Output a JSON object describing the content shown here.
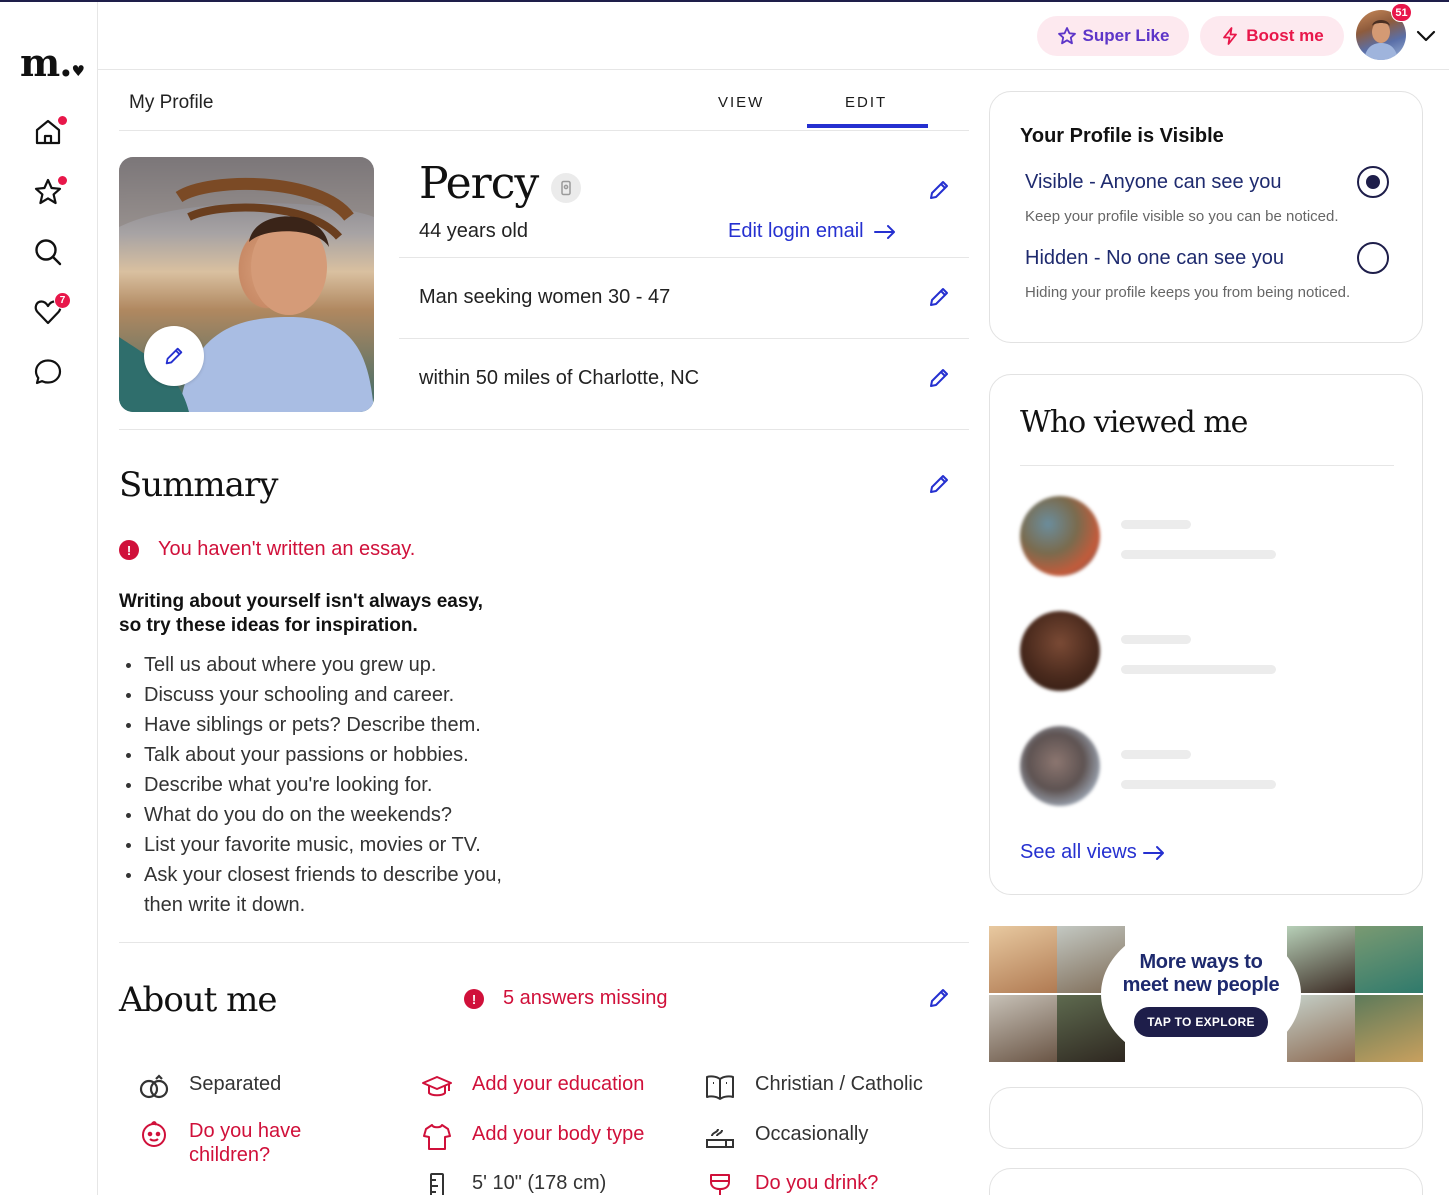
{
  "app": {
    "logo": "m.",
    "logo_heart": "♥"
  },
  "sidebar": {
    "items": [
      {
        "name": "home",
        "dot": true
      },
      {
        "name": "favorites",
        "dot": true
      },
      {
        "name": "search",
        "dot": false
      },
      {
        "name": "likes",
        "badge": "7"
      },
      {
        "name": "messages",
        "dot": false
      }
    ]
  },
  "header": {
    "super_like_label": "Super Like",
    "boost_label": "Boost me",
    "notification_count": "51"
  },
  "profile_page": {
    "page_title": "My Profile",
    "tabs": [
      {
        "label": "VIEW",
        "active": false
      },
      {
        "label": "EDIT",
        "active": true
      }
    ],
    "name": "Percy",
    "age": "44 years old",
    "edit_login_email": "Edit login email",
    "seeking": "Man seeking women 30 - 47",
    "location": "within 50 miles of Charlotte, NC"
  },
  "summary": {
    "heading": "Summary",
    "alert": "You haven't written an essay.",
    "intro_line1": "Writing about yourself isn't always easy,",
    "intro_line2": "so try these ideas for inspiration.",
    "tips": [
      "Tell us about where you grew up.",
      "Discuss your schooling and career.",
      "Have siblings or pets? Describe them.",
      "Talk about your passions or hobbies.",
      "Describe what you're looking for.",
      "What do you do on the weekends?",
      "List your favorite music, movies or TV.",
      "Ask your closest friends to describe you,",
      "then write it down."
    ]
  },
  "about_me": {
    "heading": "About me",
    "missing": "5 answers missing",
    "items": [
      {
        "icon": "rings-icon",
        "text": "Separated",
        "missing": false
      },
      {
        "icon": "graduation-cap-icon",
        "text": "Add your education",
        "missing": true
      },
      {
        "icon": "book-icon",
        "text": "Christian / Catholic",
        "missing": false
      },
      {
        "icon": "child-face-icon",
        "text": "Do you have children?",
        "missing": true
      },
      {
        "icon": "shirt-icon",
        "text": "Add your body type",
        "missing": true
      },
      {
        "icon": "smoking-icon",
        "text": "Occasionally",
        "missing": false
      },
      {
        "icon": "ruler-icon",
        "text": "5' 10\" (178 cm)",
        "missing": false
      },
      {
        "icon": "wine-glass-icon",
        "text": "Do you drink?",
        "missing": true
      }
    ]
  },
  "visibility": {
    "title": "Your Profile is Visible",
    "visible_label": "Visible - Anyone can see you",
    "visible_sub": "Keep your profile visible so you can be noticed.",
    "hidden_label": "Hidden - No one can see you",
    "hidden_sub": "Hiding your profile keeps you from being noticed.",
    "selected": "visible"
  },
  "who_viewed": {
    "heading": "Who viewed me",
    "see_all": "See all views"
  },
  "promo": {
    "title_line1": "More ways to",
    "title_line2": "meet new people",
    "cta": "TAP TO EXPLORE"
  },
  "colors": {
    "accent_blue": "#2530d0",
    "brand_red": "#e8174a",
    "alert_red": "#d0103a",
    "navy": "#1e1e4a",
    "super_like_purple": "#5d35c8"
  }
}
